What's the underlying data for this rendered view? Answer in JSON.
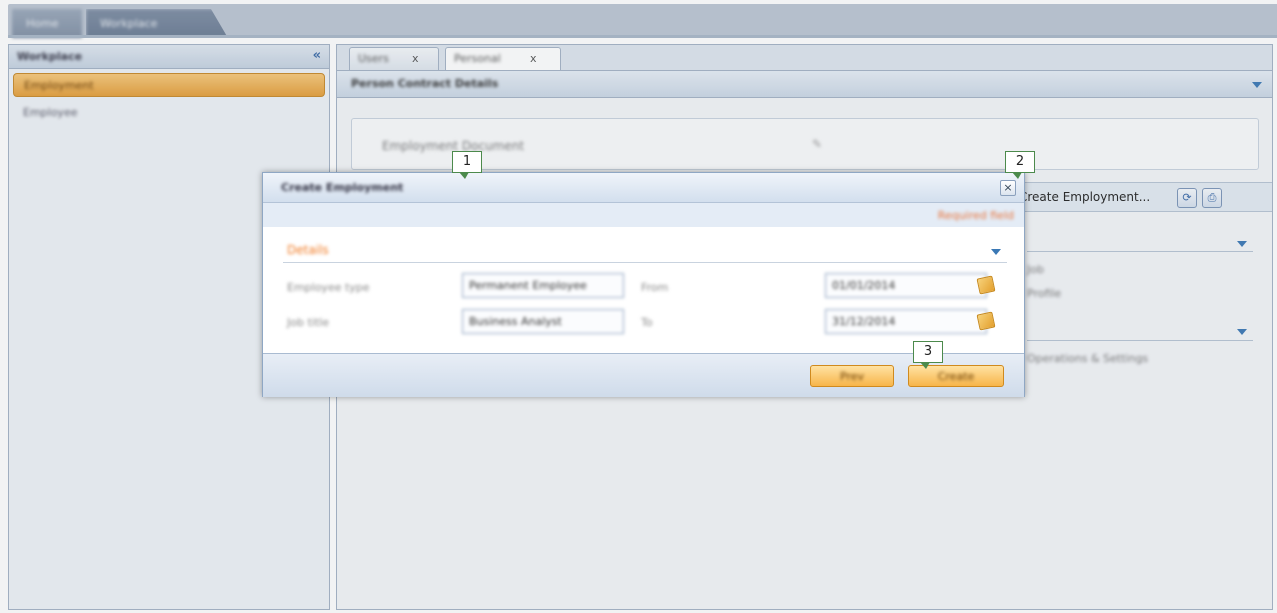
{
  "top_tabs": [
    "Home",
    "Workplace"
  ],
  "sidebar": {
    "title": "Workplace",
    "collapse_glyph": "«",
    "items": [
      {
        "label": "Employment",
        "active": true
      },
      {
        "label": "Employee",
        "active": false
      }
    ]
  },
  "main": {
    "tabs": [
      {
        "label": "Users",
        "close": "x"
      },
      {
        "label": "Personal",
        "close": "x"
      }
    ],
    "panel_title": "Person Contract Details",
    "inner_text": "Employment Document",
    "inner_pen": "✎",
    "create_employment_label": "Create Employment...",
    "refresh_glyph": "⟳",
    "print_glyph": "⎙",
    "right_text_1": "Job",
    "right_text_2": "Profile",
    "right_text_3": "Operations & Settings"
  },
  "dialog": {
    "title": "Create Employment",
    "close_glyph": "×",
    "link_text": "Required field",
    "section_title": "Details",
    "fields": [
      {
        "label": "Employee type",
        "value": "Permanent Employee"
      },
      {
        "label": "From",
        "value": "01/01/2014"
      },
      {
        "label": "Job title",
        "value": "Business Analyst"
      },
      {
        "label": "To",
        "value": "31/12/2014"
      }
    ],
    "buttons": {
      "prev": "Prev",
      "create": "Create"
    }
  },
  "callouts": [
    "1",
    "2",
    "3"
  ],
  "icons": {
    "collapse": "double-chevron-left-icon",
    "down": "triangle-down-icon",
    "calendar": "calendar-icon",
    "close": "close-icon",
    "refresh": "refresh-icon",
    "print": "print-icon",
    "pen": "pen-icon"
  },
  "colors": {
    "accent_orange": "#f7b54a",
    "header_blue": "#cbd8e6",
    "link_orange": "#e8743b",
    "callout_border": "#4c8a4c"
  }
}
